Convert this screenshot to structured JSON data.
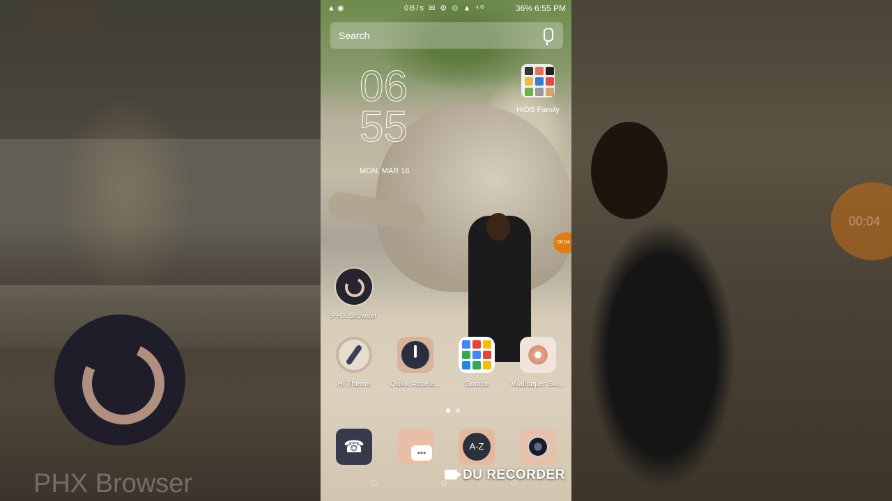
{
  "status_bar": {
    "left_icons": "▲ ◉",
    "signals": "0B/s ✉ ⚙ ⊙ ▲ ⁴ᴳ",
    "battery": "36%",
    "time": "6:55 PM"
  },
  "search": {
    "placeholder": "Search"
  },
  "clock": {
    "hour": "06",
    "minute": "55",
    "date": "MON, MAR 16"
  },
  "folder": {
    "label": "HiOS Family",
    "colors": [
      "#333",
      "#e8705a",
      "#222",
      "#f2b84b",
      "#3a7bd5",
      "#e04a4a",
      "#6ab04c",
      "#999",
      "#d4a373"
    ]
  },
  "recorder_bubble": {
    "time": "00:04"
  },
  "background": {
    "left_label": "PHX Browser",
    "right_bubble_time": "00:04"
  },
  "apps": {
    "phx": "PHX Browser",
    "row": [
      {
        "label": "Hi Theme",
        "icon": "hi-theme-icon"
      },
      {
        "label": "Quick Accele...",
        "icon": "quick-accelerator-icon"
      },
      {
        "label": "Google",
        "icon": "google-folder-icon"
      },
      {
        "label": "Wallpaper Sw...",
        "icon": "wallpaper-switch-icon"
      }
    ]
  },
  "google_colors": [
    "#4285f4",
    "#ea4335",
    "#fbbc05",
    "#34a853",
    "#4285f4",
    "#ea4335",
    "#1e88e5",
    "#34a853",
    "#fbbc05"
  ],
  "dock": [
    "phone-icon",
    "messages-icon",
    "contacts-icon",
    "camera-icon"
  ],
  "watermark": "DU RECORDER",
  "nav": {
    "back": "◌",
    "home": "○",
    "recent": "◌"
  }
}
